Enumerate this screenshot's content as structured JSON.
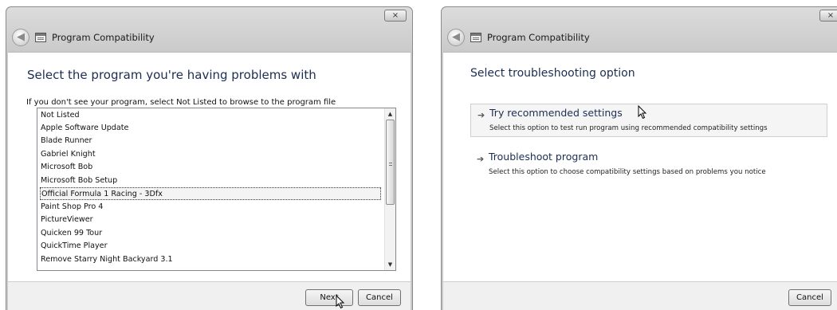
{
  "window1": {
    "title": "Program Compatibility",
    "close_icon": "×",
    "back_icon": "◀",
    "heading": "Select the program you're having problems with",
    "instruction": "If you don't see your program, select Not Listed to browse to the program file",
    "programs": [
      "Not Listed",
      "Apple Software Update",
      "Blade Runner",
      "Gabriel Knight",
      "Microsoft Bob",
      "Microsoft Bob Setup",
      "Official Formula 1 Racing - 3Dfx",
      "Paint Shop Pro 4",
      "PictureViewer",
      "Quicken 99 Tour",
      "QuickTime Player",
      "Remove Starry Night Backyard 3.1"
    ],
    "selected_program": "Official Formula 1 Racing - 3Dfx",
    "scroll_up": "▲",
    "scroll_down": "▼",
    "next_label": "Next",
    "cancel_label": "Cancel"
  },
  "window2": {
    "title": "Program Compatibility",
    "close_icon": "×",
    "back_icon": "◀",
    "heading": "Select troubleshooting option",
    "options": [
      {
        "arrow": "➔",
        "title": "Try recommended settings",
        "description": "Select this option to test run program using recommended compatibility settings"
      },
      {
        "arrow": "➔",
        "title": "Troubleshoot program",
        "description": "Select this option to choose compatibility settings based on problems you notice"
      }
    ],
    "cancel_label": "Cancel"
  },
  "icons": [
    "back-arrow-icon",
    "program-compatibility-icon",
    "close-icon",
    "arrow-right-icon",
    "mouse-cursor-icon"
  ]
}
